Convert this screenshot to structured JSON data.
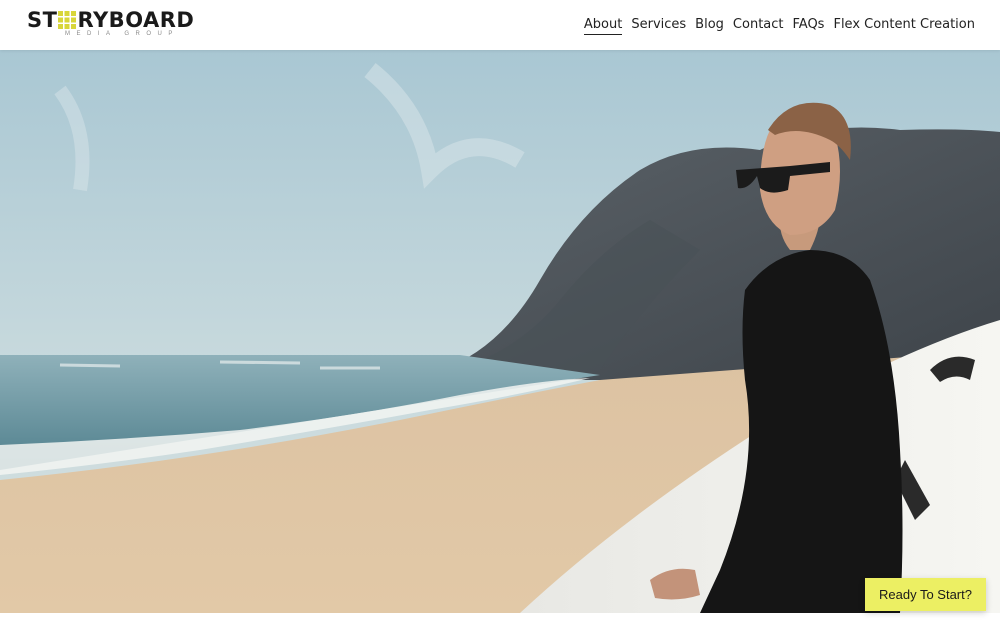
{
  "brand": {
    "name_prefix": "ST",
    "name_suffix": "RYBOARD",
    "tagline": "MEDIA GROUP",
    "logo_mark_color": "#d8d63a",
    "logo_icon": "grid-o-icon"
  },
  "nav": {
    "items": [
      {
        "label": "About",
        "active": true
      },
      {
        "label": "Services",
        "active": false
      },
      {
        "label": "Blog",
        "active": false
      },
      {
        "label": "Contact",
        "active": false
      },
      {
        "label": "FAQs",
        "active": false
      },
      {
        "label": "Flex Content Creation",
        "active": false
      }
    ]
  },
  "hero": {
    "scene": "surfer-on-beach-image"
  },
  "cta": {
    "label": "Ready To Start?",
    "color": "#ecef63"
  }
}
